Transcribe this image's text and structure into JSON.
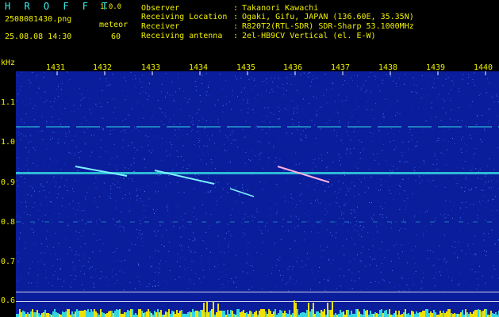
{
  "header": {
    "app_name": "H R O F F T",
    "app_version": "1.0.0",
    "filename": "2508081430.png",
    "mode_label": "meteor",
    "datetime": "25.08.08 14:30",
    "count": "60",
    "info": [
      {
        "key": "Observer",
        "value": "Takanori Kawachi"
      },
      {
        "key": "Receiving Location",
        "value": "Ogaki, Gifu, JAPAN (136.60E, 35.35N)"
      },
      {
        "key": "Receiver",
        "value": "R820T2(RTL-SDR) SDR-Sharp 53.1000MHz"
      },
      {
        "key": "Receiving antenna",
        "value": "2el-HB9CV Vertical (el. E-W)"
      }
    ]
  },
  "spectrogram": {
    "y_unit": "kHz",
    "x_ticks": [
      "1431",
      "1432",
      "1433",
      "1434",
      "1435",
      "1436",
      "1437",
      "1438",
      "1439",
      "1440"
    ],
    "y_ticks": [
      "1.1",
      "1.0",
      "0.9",
      "0.8",
      "0.7",
      "0.6"
    ],
    "colors": {
      "background": "#0a1d9a",
      "carrier": "#33d6e0",
      "text": "#f0f000",
      "activity": "#f0e000"
    }
  }
}
